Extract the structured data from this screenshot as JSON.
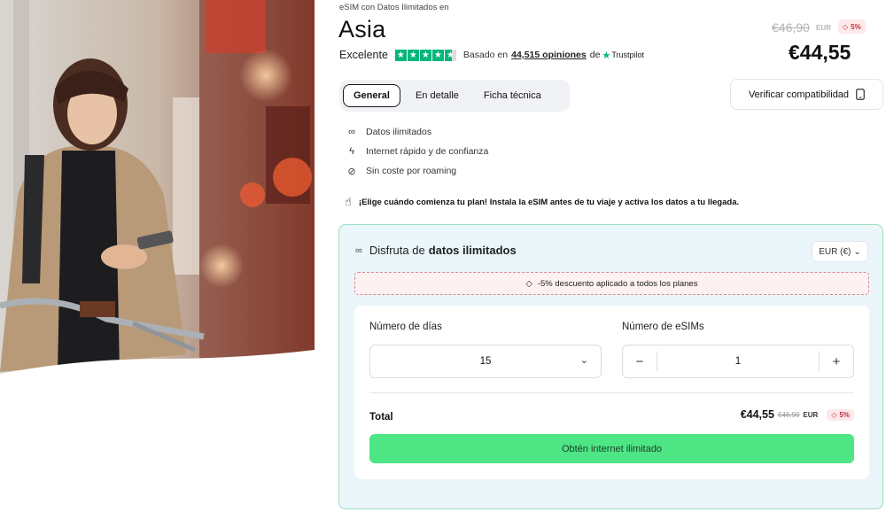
{
  "product": {
    "eyebrow": "eSIM con Datos Ilimitados en",
    "title": "Asia",
    "rating_word": "Excelente",
    "based_on": "Basado en",
    "reviews": "44,515 opiniones",
    "de": "de",
    "trustpilot": "Trustpilot",
    "old_price": "€46,90",
    "old_currency": "EUR",
    "discount_badge": "5%",
    "price": "€44,55"
  },
  "tabs": [
    {
      "label": "General",
      "active": true
    },
    {
      "label": "En detalle",
      "active": false
    },
    {
      "label": "Ficha técnica",
      "active": false
    }
  ],
  "verify_label": "Verificar compatibilidad",
  "features": [
    {
      "icon": "infinity-icon",
      "label": "Datos ilimitados"
    },
    {
      "icon": "bolt-icon",
      "label": "Internet rápido y de confianza"
    },
    {
      "icon": "no-roaming-icon",
      "label": "Sin coste por roaming"
    }
  ],
  "notice": "¡Elige cuándo comienza tu plan! Instala la eSIM antes de tu viaje y activa los datos a tu llegada.",
  "plan": {
    "title_prefix": "Disfruta de",
    "title_bold": "datos ilimitados",
    "currency": "EUR (€)",
    "discount_text": "-5% descuento aplicado a todos los planes",
    "days_label": "Número de días",
    "days_value": "15",
    "esims_label": "Número de eSIMs",
    "esims_value": "1",
    "total_label": "Total",
    "total_price": "€44,55",
    "total_old": "€46,90",
    "total_currency": "EUR",
    "total_badge": "5%",
    "cta": "Obtén internet ilimitado"
  },
  "colors": {
    "trustpilot_green": "#00b67a",
    "cta_green": "#4ee585",
    "card_bg": "#eaf6fa",
    "card_border": "#9edfc1",
    "badge_bg": "#fde8ea",
    "badge_text": "#c0303d"
  }
}
